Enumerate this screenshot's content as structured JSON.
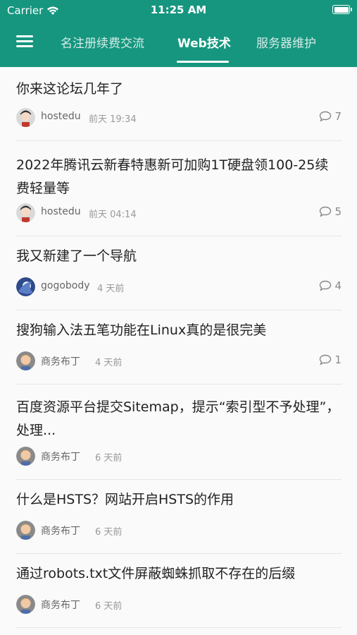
{
  "status_bar": {
    "carrier": "Carrier",
    "time": "11:25 AM",
    "icons": [
      "wifi-icon",
      "battery-icon"
    ]
  },
  "nav": {
    "menu_icon": "hamburger-menu-icon",
    "tabs": [
      {
        "label": "名注册续费交流",
        "active": false
      },
      {
        "label": "Web技术",
        "active": true
      },
      {
        "label": "服务器维护",
        "active": false
      }
    ]
  },
  "colors": {
    "header": "#16967f",
    "active_tab_underline": "#ffffff",
    "feed_background": "#fafafa"
  },
  "posts": [
    {
      "title": "你来这论坛几年了",
      "author": "hostedu",
      "time": "前天 19:34",
      "replies": "7"
    },
    {
      "title": "2022年腾讯云新春特惠新可加购1T硬盘领100-25续费轻量等",
      "author": "hostedu",
      "time": "前天 04:14",
      "replies": "5"
    },
    {
      "title": "我又新建了一个导航",
      "author": "gogobody",
      "time": "4 天前",
      "replies": "4"
    },
    {
      "title": "搜狗输入法五笔功能在Linux真的是很完美",
      "author": "商务布丁",
      "time": "4 天前",
      "replies": "1"
    },
    {
      "title": "百度资源平台提交Sitemap，提示“索引型不予处理”，处理...",
      "author": "商务布丁",
      "time": "6 天前",
      "replies": ""
    },
    {
      "title": "什么是HSTS？网站开启HSTS的作用",
      "author": "商务布丁",
      "time": "6 天前",
      "replies": ""
    },
    {
      "title": "通过robots.txt文件屏蔽蜘蛛抓取不存在的后缀",
      "author": "商务布丁",
      "time": "6 天前",
      "replies": ""
    }
  ]
}
